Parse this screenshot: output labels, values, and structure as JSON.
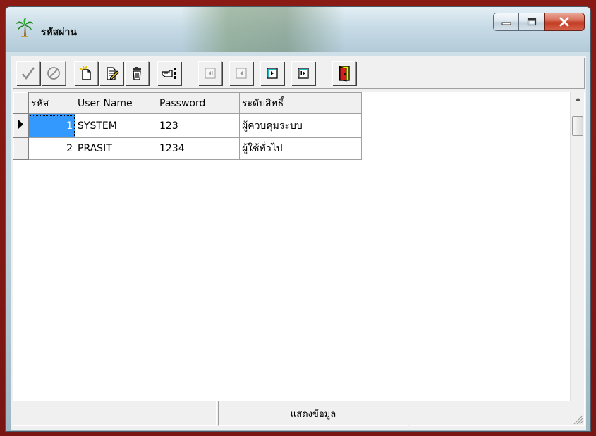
{
  "window": {
    "title": "รหัสผ่าน",
    "caption_buttons": [
      "minimize",
      "maximize",
      "close"
    ]
  },
  "toolbar": {
    "buttons": [
      {
        "icon": "checkmark-icon",
        "label": "post"
      },
      {
        "icon": "cancel-icon",
        "label": "cancel"
      },
      {
        "icon": "new-document-icon",
        "label": "insert"
      },
      {
        "icon": "edit-document-icon",
        "label": "edit"
      },
      {
        "icon": "trash-icon",
        "label": "delete"
      },
      {
        "icon": "hand-pointer-icon",
        "label": "refresh"
      },
      {
        "icon": "first-record-icon",
        "label": "first"
      },
      {
        "icon": "prior-record-icon",
        "label": "prior"
      },
      {
        "icon": "next-record-icon",
        "label": "next"
      },
      {
        "icon": "last-record-icon",
        "label": "last"
      },
      {
        "icon": "exit-door-icon",
        "label": "exit"
      }
    ]
  },
  "grid": {
    "columns": [
      "รหัส",
      "User Name",
      "Password",
      "ระดับสิทธิ์"
    ],
    "rows": [
      {
        "id": "1",
        "username": "SYSTEM",
        "password": "123",
        "level": "ผู้ควบคุมระบบ"
      },
      {
        "id": "2",
        "username": "PRASIT",
        "password": "1234",
        "level": "ผู้ใช้ทั่วไป"
      }
    ]
  },
  "statusbar": {
    "panels": [
      "",
      "แสดงข้อมูล",
      ""
    ]
  },
  "colors": {
    "selection": "#3399ff",
    "background": "#f0f0f0",
    "close_button": "#c23b22"
  }
}
